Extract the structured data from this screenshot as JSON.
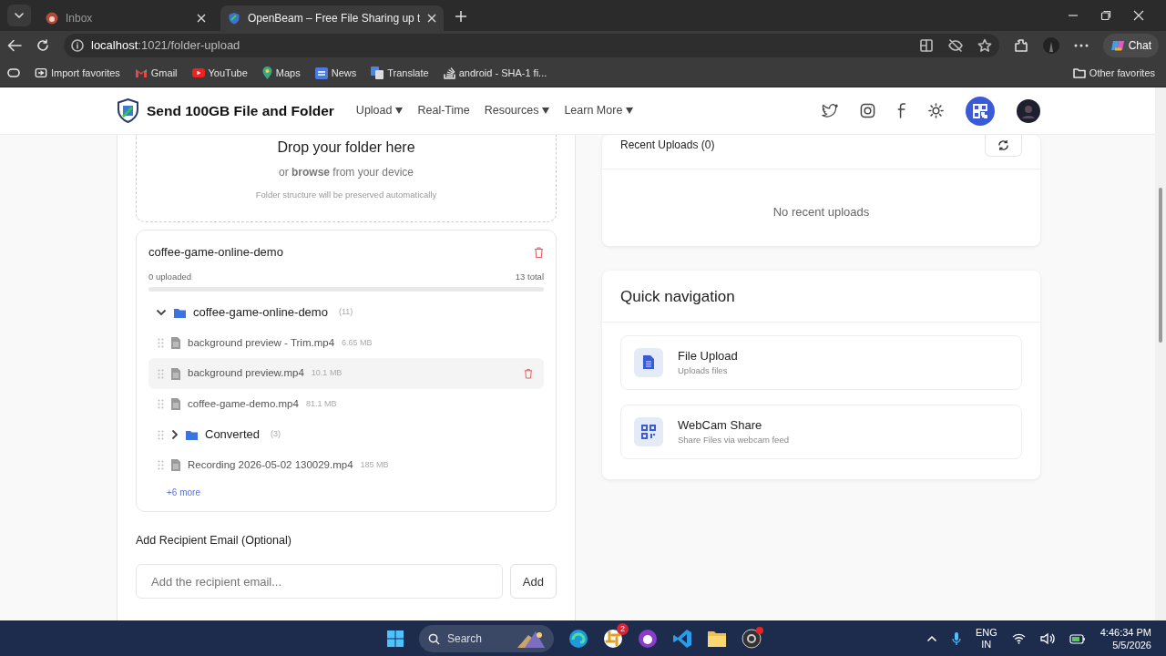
{
  "browser": {
    "tabs": [
      {
        "title": "Inbox",
        "selected": false
      },
      {
        "title": "OpenBeam – Free File Sharing up t",
        "selected": true
      }
    ],
    "address": {
      "host": "localhost",
      "path": ":1021/folder-upload"
    },
    "chat": "Chat",
    "bookmarks": [
      {
        "label": "Import favorites",
        "kind": "import"
      },
      {
        "label": "Gmail",
        "kind": "gmail"
      },
      {
        "label": "YouTube",
        "kind": "youtube"
      },
      {
        "label": "Maps",
        "kind": "maps"
      },
      {
        "label": "News",
        "kind": "news"
      },
      {
        "label": "Translate",
        "kind": "translate"
      },
      {
        "label": "android - SHA-1 fi...",
        "kind": "stack"
      }
    ],
    "other_favorites": "Other favorites"
  },
  "header": {
    "brand": "Send 100GB File and Folder",
    "nav": [
      {
        "label": "Upload",
        "dropdown": true
      },
      {
        "label": "Real-Time",
        "dropdown": false
      },
      {
        "label": "Resources",
        "dropdown": true
      },
      {
        "label": "Learn More",
        "dropdown": true
      }
    ]
  },
  "dropzone": {
    "title": "Drop your folder here",
    "lead": "or **browse** from your device",
    "note": "Folder structure will be preserved automatically"
  },
  "folder": {
    "name": "coffee-game-online-demo",
    "uploaded": "0 uploaded",
    "total": "13 total",
    "level": 0,
    "tree": {
      "kind": "folder",
      "name": "coffee-game-online-demo",
      "count": "(11)",
      "expanded": true,
      "children": [
        {
          "kind": "file",
          "name": "background preview - Trim.mp4",
          "size": "6.65 MB",
          "hovered": false
        },
        {
          "kind": "file",
          "name": "background preview.mp4",
          "size": "10.1 MB",
          "hovered": true
        },
        {
          "kind": "file",
          "name": "coffee-game-demo.mp4",
          "size": "81.1 MB",
          "hovered": false
        },
        {
          "kind": "folder",
          "name": "Converted",
          "count": "(3)",
          "expanded": false
        },
        {
          "kind": "file",
          "name": "Recording 2026-05-02 130029.mp4",
          "size": "185 MB",
          "hovered": false
        }
      ]
    },
    "more": "+6 more"
  },
  "recipient": {
    "label": "Add Recipient Email (Optional)",
    "placeholder": "Add the recipient email...",
    "button": "Add"
  },
  "recent": {
    "title": "Recent Uploads (0)",
    "empty": "No recent uploads"
  },
  "quick_nav": {
    "title": "Quick navigation",
    "items": [
      {
        "title": "File Upload",
        "subtitle": "Uploads files",
        "kind": "file"
      },
      {
        "title": "WebCam Share",
        "subtitle": "Share Files via webcam feed",
        "kind": "qr"
      }
    ]
  },
  "taskbar": {
    "search": "Search",
    "slack_badge": "2",
    "lang": "ENG",
    "region": "IN",
    "time": "4:46:34 PM",
    "date": "5/5/2026"
  }
}
